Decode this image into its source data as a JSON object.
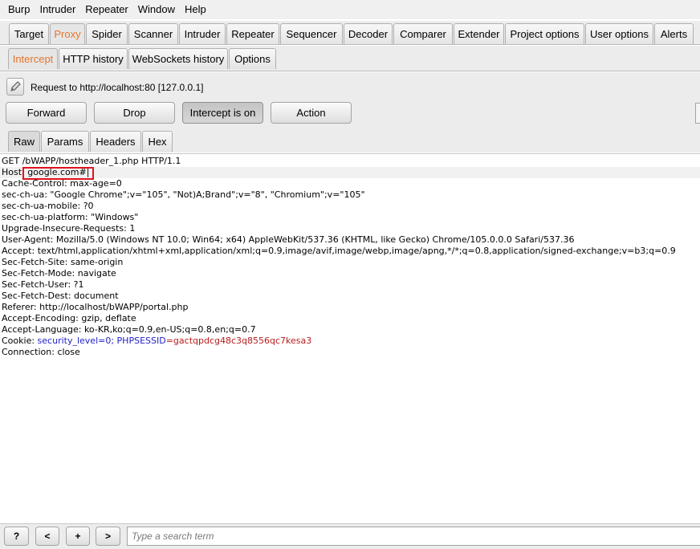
{
  "menu": [
    "Burp",
    "Intruder",
    "Repeater",
    "Window",
    "Help"
  ],
  "main_tabs": [
    "Target",
    "Proxy",
    "Spider",
    "Scanner",
    "Intruder",
    "Repeater",
    "Sequencer",
    "Decoder",
    "Comparer",
    "Extender",
    "Project options",
    "User options",
    "Alerts"
  ],
  "proxy_tabs": [
    "Intercept",
    "HTTP history",
    "WebSockets history",
    "Options"
  ],
  "intercept": {
    "request_label": "Request to http://localhost:80  [127.0.0.1]",
    "buttons": [
      "Forward",
      "Drop",
      "Intercept is on",
      "Action"
    ]
  },
  "editor_tabs": [
    "Raw",
    "Params",
    "Headers",
    "Hex"
  ],
  "request": {
    "line1": "GET /bWAPP/hostheader_1.php HTTP/1.1",
    "host_prefix": "Host: ",
    "host_value": "google.com#",
    "lines": [
      "Cache-Control: max-age=0",
      "sec-ch-ua: \"Google Chrome\";v=\"105\", \"Not)A;Brand\";v=\"8\", \"Chromium\";v=\"105\"",
      "sec-ch-ua-mobile: ?0",
      "sec-ch-ua-platform: \"Windows\"",
      "Upgrade-Insecure-Requests: 1",
      "User-Agent: Mozilla/5.0 (Windows NT 10.0; Win64; x64) AppleWebKit/537.36 (KHTML, like Gecko) Chrome/105.0.0.0 Safari/537.36",
      "Accept: text/html,application/xhtml+xml,application/xml;q=0.9,image/avif,image/webp,image/apng,*/*;q=0.8,application/signed-exchange;v=b3;q=0.9",
      "Sec-Fetch-Site: same-origin",
      "Sec-Fetch-Mode: navigate",
      "Sec-Fetch-User: ?1",
      "Sec-Fetch-Dest: document",
      "Referer: http://localhost/bWAPP/portal.php",
      "Accept-Encoding: gzip, deflate",
      "Accept-Language: ko-KR,ko;q=0.9,en-US;q=0.8,en;q=0.7"
    ],
    "cookie_prefix": "Cookie: ",
    "cookie_k1": "security_level",
    "cookie_v1": "=0; ",
    "cookie_k2": "PHPSESSID",
    "cookie_v2": "=gactqpdcg48c3q8556qc7kesa3",
    "last_line": "Connection: close"
  },
  "search": {
    "buttons": [
      "?",
      "<",
      "+",
      ">"
    ],
    "placeholder": "Type a search term"
  },
  "colors": {
    "accent": "#e8732c",
    "highlight": "#e0141e",
    "param_name": "#1f1fc8",
    "param_value": "#b71c1c"
  }
}
